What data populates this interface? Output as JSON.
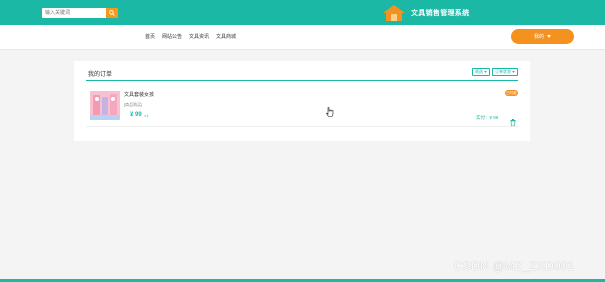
{
  "header": {
    "search": {
      "placeholder": "输入关键词",
      "icon": "search-icon"
    },
    "site_title": "文具销售管理系统",
    "logo_icon": "house-icon",
    "brand_color": "#1cb8a6"
  },
  "nav": {
    "items": [
      "首页",
      "网站公告",
      "文具资讯",
      "文具商城"
    ],
    "mine_label": "我的"
  },
  "orders": {
    "title": "我的订单",
    "filters": [
      {
        "label": "筛选"
      },
      {
        "label": "订单状态"
      }
    ],
    "items": [
      {
        "name": "文具套装女孩",
        "status": "[商品购买]",
        "price": "¥ 99",
        "qty": "×1",
        "badge": "已付款",
        "paid_label": "实付：",
        "paid_amount": "¥ 99"
      }
    ]
  },
  "watermark": "CSDN @MZ_ZXD001",
  "colors": {
    "accent": "#f5921f",
    "primary": "#1cb8a6"
  }
}
